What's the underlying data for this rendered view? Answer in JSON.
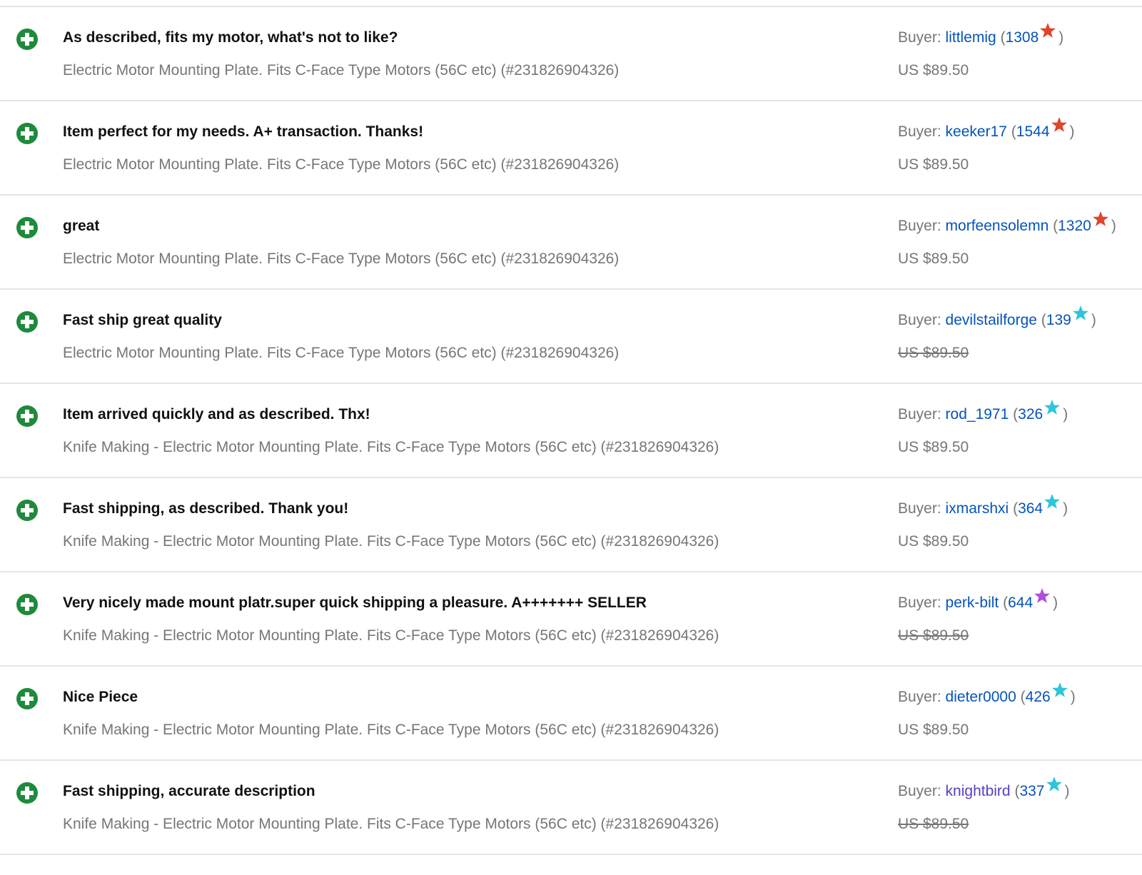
{
  "buyer_label": "Buyer:",
  "colors": {
    "positive_icon": "#1e8a3c",
    "star_red": "#e0442b",
    "star_teal": "#2ec5dc",
    "star_purple": "#b04fd6",
    "link": "#0654ba",
    "link_visited": "#5a3ec8"
  },
  "feedback": [
    {
      "comment": "As described, fits my motor, what's not to like?",
      "item": "Electric Motor Mounting Plate. Fits C-Face Type Motors (56C etc) (#231826904326)",
      "buyer": "littlemig",
      "score_open": "(",
      "score": "1308",
      "score_close": ")",
      "star_color": "red",
      "price": "US $89.50",
      "price_struck": false,
      "buyer_visited": false
    },
    {
      "comment": "Item perfect for my needs. A+ transaction. Thanks!",
      "item": "Electric Motor Mounting Plate. Fits C-Face Type Motors (56C etc) (#231826904326)",
      "buyer": "keeker17",
      "score_open": "(",
      "score": "1544",
      "score_close": ")",
      "star_color": "red",
      "price": "US $89.50",
      "price_struck": false,
      "buyer_visited": false
    },
    {
      "comment": "great",
      "item": "Electric Motor Mounting Plate. Fits C-Face Type Motors (56C etc) (#231826904326)",
      "buyer": "morfeensolemn",
      "score_open": "(",
      "score": "1320",
      "score_close": ")",
      "star_color": "red",
      "price": "US $89.50",
      "price_struck": false,
      "buyer_visited": false
    },
    {
      "comment": "Fast ship great quality",
      "item": "Electric Motor Mounting Plate. Fits C-Face Type Motors (56C etc) (#231826904326)",
      "buyer": "devilstailforge",
      "score_open": "(",
      "score": "139",
      "score_close": ")",
      "star_color": "teal",
      "price": "US $89.50",
      "price_struck": true,
      "buyer_visited": false
    },
    {
      "comment": "Item arrived quickly and as described. Thx!",
      "item": "Knife Making - Electric Motor Mounting Plate. Fits C-Face Type Motors (56C etc) (#231826904326)",
      "buyer": "rod_1971",
      "score_open": "(",
      "score": "326",
      "score_close": ")",
      "star_color": "teal",
      "price": "US $89.50",
      "price_struck": false,
      "buyer_visited": false
    },
    {
      "comment": "Fast shipping, as described. Thank you!",
      "item": "Knife Making - Electric Motor Mounting Plate. Fits C-Face Type Motors (56C etc) (#231826904326)",
      "buyer": "ixmarshxi",
      "score_open": "(",
      "score": "364",
      "score_close": ")",
      "star_color": "teal",
      "price": "US $89.50",
      "price_struck": false,
      "buyer_visited": false
    },
    {
      "comment": "Very nicely made mount platr.super quick shipping a pleasure. A+++++++ SELLER",
      "item": "Knife Making - Electric Motor Mounting Plate. Fits C-Face Type Motors (56C etc) (#231826904326)",
      "buyer": "perk-bilt",
      "score_open": "(",
      "score": "644",
      "score_close": ")",
      "star_color": "purple",
      "price": "US $89.50",
      "price_struck": true,
      "buyer_visited": false
    },
    {
      "comment": "Nice Piece",
      "item": "Knife Making - Electric Motor Mounting Plate. Fits C-Face Type Motors (56C etc) (#231826904326)",
      "buyer": "dieter0000",
      "score_open": "(",
      "score": "426",
      "score_close": ")",
      "star_color": "teal",
      "price": "US $89.50",
      "price_struck": false,
      "buyer_visited": false
    },
    {
      "comment": "Fast shipping, accurate description",
      "item": "Knife Making - Electric Motor Mounting Plate. Fits C-Face Type Motors (56C etc) (#231826904326)",
      "buyer": "knightbird",
      "score_open": "(",
      "score": "337",
      "score_close": ")",
      "star_color": "teal",
      "price": "US $89.50",
      "price_struck": true,
      "buyer_visited": true
    }
  ]
}
